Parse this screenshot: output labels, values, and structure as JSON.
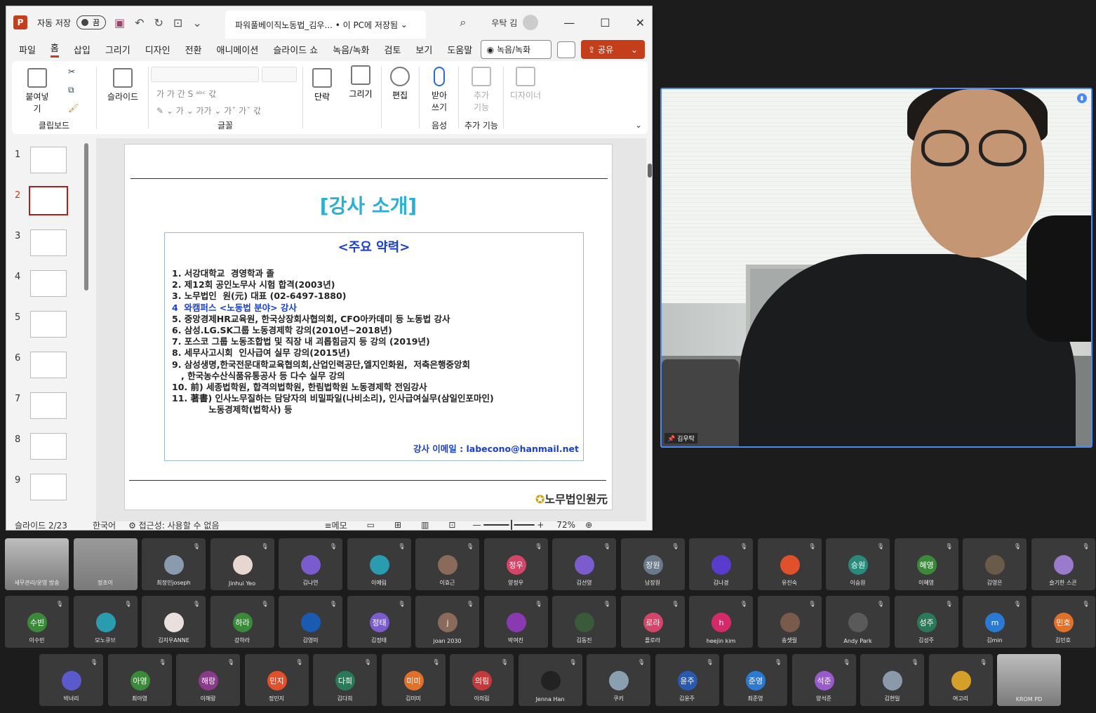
{
  "ppt": {
    "autosave_label": "자동 저장",
    "toggle_label": "끔",
    "doc_title": "파워풀베이직노동법_김우...  •  이 PC에 저장됨",
    "user_name": "우탁 김",
    "menu": [
      "파일",
      "홈",
      "삽입",
      "그리기",
      "디자인",
      "전환",
      "애니메이션",
      "슬라이드 쇼",
      "녹음/녹화",
      "검토",
      "보기",
      "도움말"
    ],
    "record_label": "녹음/녹화",
    "share_label": "공유",
    "ribbon": {
      "paste": "붙여넣기",
      "clipboard": "클립보드",
      "slide": "슬라이드",
      "font": "글꼴",
      "paragraph": "단락",
      "draw": "그리기",
      "edit": "편집",
      "dictate": "받아\n쓰기",
      "voice": "음성",
      "addins": "추가\n기능",
      "addins_group": "추가 기능",
      "designer": "디자이너"
    },
    "slide_numbers": [
      "1",
      "2",
      "3",
      "4",
      "5",
      "6",
      "7",
      "8",
      "9"
    ],
    "slide": {
      "title": "[강사 소개]",
      "career_header": "<주요 약력>",
      "items": [
        {
          "text": "1. 서강대학교  경영학과 졸",
          "blue": false
        },
        {
          "text": "2. 제12회 공인노무사 시험 합격(2003년)",
          "blue": false
        },
        {
          "text": "3. 노무법인  원(元) 대표 (02-6497-1880)",
          "blue": false
        },
        {
          "text": "4  와캠퍼스 <노동법 분야> 강사",
          "blue": true
        },
        {
          "text": "5. 중앙경제HR교육원, 한국상장회사협의회, CFO아카데미 등 노동법 강사",
          "blue": false
        },
        {
          "text": "6. 삼성.LG.SK그룹 노동경제학 강의(2010년~2018년)",
          "blue": false
        },
        {
          "text": "7. 포스코 그룹 노동조합법 및 직장 내 괴롭힘금지 등 강의 (2019년)",
          "blue": false
        },
        {
          "text": "8. 세무사고시회  인사급여 실무 강의(2015년)",
          "blue": false
        },
        {
          "text": "9. 삼성생명,한국전문대학교육협의회,산업인력공단,엘지인화원,  저축은행중앙회",
          "blue": false
        },
        {
          "text": "   , 한국농수산식품유통공사 등 다수 실무 강의",
          "blue": false
        },
        {
          "text": "10. 前) 세종법학원, 합격의법학원, 한림법학원 노동경제학 전임강사",
          "blue": false
        },
        {
          "text": "11. 著書) 인사노무질하는 담당자의 비밀파일(나비소리), 인사급여실무(삼일인포마인)",
          "blue": false
        },
        {
          "text": "            노동경제학(법학사) 등",
          "blue": false
        }
      ],
      "email": "강사 이메일 : labecono@hanmail.net",
      "logo_text": "노무법인",
      "logo_accent": "원元"
    },
    "status": {
      "slide_pos": "슬라이드 2/23",
      "lang": "한국어",
      "access": "접근성: 사용할 수 없음",
      "notes": "메모",
      "zoom": "72%"
    }
  },
  "camera": {
    "label": "김우탁"
  },
  "participants": [
    {
      "name": "세무관리/운영 방송",
      "initial": "",
      "color": "#bdbdbd",
      "video": true
    },
    {
      "name": "정조이",
      "initial": "",
      "color": "#9a9a9a",
      "video": true
    },
    {
      "name": "최정민joseph",
      "initial": "",
      "color": "#8a9bb0",
      "video": false
    },
    {
      "name": "Jinhui Yeo",
      "initial": "",
      "color": "#e8d6d0",
      "video": false
    },
    {
      "name": "김나연",
      "initial": "",
      "color": "#7a5ccc",
      "video": false
    },
    {
      "name": "이예림",
      "initial": "",
      "color": "#2a9cb0",
      "video": false
    },
    {
      "name": "이효근",
      "initial": "",
      "color": "#8a6a5a",
      "video": false
    },
    {
      "name": "양정우",
      "initial": "정우",
      "color": "#d4456a",
      "video": false
    },
    {
      "name": "김선영",
      "initial": "",
      "color": "#7a5ccc",
      "video": false
    },
    {
      "name": "남장원",
      "initial": "장원",
      "color": "#6a7a8a",
      "video": false
    },
    {
      "name": "김나경",
      "initial": "",
      "color": "#5a3ccc",
      "video": false
    },
    {
      "name": "유진숙",
      "initial": "",
      "color": "#e0502a",
      "video": false
    },
    {
      "name": "이승원",
      "initial": "승원",
      "color": "#2a8a7a",
      "video": false
    },
    {
      "name": "이혜영",
      "initial": "혜영",
      "color": "#3a8a3a",
      "video": false
    },
    {
      "name": "김영은",
      "initial": "",
      "color": "#6a5a4a",
      "video": false
    },
    {
      "name": "슬기한 스콘",
      "initial": "",
      "color": "#9a7acc",
      "video": false
    },
    {
      "name": "이수빈",
      "initial": "수빈",
      "color": "#3a8a3a",
      "video": false
    },
    {
      "name": "모노큐브",
      "initial": "",
      "color": "#2a9cb0",
      "video": false
    },
    {
      "name": "김지우ANNE",
      "initial": "",
      "color": "#e8e0dc",
      "video": false
    },
    {
      "name": "강하라",
      "initial": "하라",
      "color": "#3a8a3a",
      "video": false
    },
    {
      "name": "김영미",
      "initial": "",
      "color": "#1a5ab0",
      "video": false
    },
    {
      "name": "김정태",
      "initial": "정태",
      "color": "#7a5ccc",
      "video": false
    },
    {
      "name": "joan 2030",
      "initial": "j",
      "color": "#8a6a5a",
      "video": false
    },
    {
      "name": "박여진",
      "initial": "",
      "color": "#8a3ab0",
      "video": false
    },
    {
      "name": "김동진",
      "initial": "",
      "color": "#3a5a3a",
      "video": false
    },
    {
      "name": "플로라",
      "initial": "로라",
      "color": "#d4456a",
      "video": false
    },
    {
      "name": "heejin kim",
      "initial": "h",
      "color": "#d42a6a",
      "video": false
    },
    {
      "name": "송셋릴",
      "initial": "",
      "color": "#7a5a4a",
      "video": false
    },
    {
      "name": "Andy Park",
      "initial": "",
      "color": "#5a5a5a",
      "video": false
    },
    {
      "name": "김성주",
      "initial": "성주",
      "color": "#2a7a5a",
      "video": false
    },
    {
      "name": "김min",
      "initial": "m",
      "color": "#2a7ad4",
      "video": false
    },
    {
      "name": "김민호",
      "initial": "민호",
      "color": "#e0702a",
      "video": false
    },
    {
      "name": "박녀리",
      "initial": "",
      "color": "#5a5acc",
      "video": false
    },
    {
      "name": "최아영",
      "initial": "아영",
      "color": "#3a8a3a",
      "video": false
    },
    {
      "name": "이해랑",
      "initial": "해랑",
      "color": "#8a3a8a",
      "video": false
    },
    {
      "name": "정민지",
      "initial": "민지",
      "color": "#e0502a",
      "video": false
    },
    {
      "name": "김다희",
      "initial": "다희",
      "color": "#2a7a5a",
      "video": false
    },
    {
      "name": "김미미",
      "initial": "미미",
      "color": "#e0702a",
      "video": false
    },
    {
      "name": "이의림",
      "initial": "의림",
      "color": "#c43a3a",
      "video": false
    },
    {
      "name": "Jenna Han",
      "initial": "",
      "color": "#222222",
      "video": false
    },
    {
      "name": "쿠키",
      "initial": "",
      "color": "#8aa0b0",
      "video": false
    },
    {
      "name": "김윤주",
      "initial": "윤주",
      "color": "#2a5ab0",
      "video": false
    },
    {
      "name": "최준영",
      "initial": "준영",
      "color": "#2a7ad4",
      "video": false
    },
    {
      "name": "양석준",
      "initial": "석준",
      "color": "#9a5acc",
      "video": false
    },
    {
      "name": "김현일",
      "initial": "",
      "color": "#8a9aaa",
      "video": false
    },
    {
      "name": "여고리",
      "initial": "",
      "color": "#d4a02a",
      "video": false
    },
    {
      "name": "KROM PD",
      "initial": "",
      "color": "#bdbdbd",
      "video": true
    }
  ]
}
